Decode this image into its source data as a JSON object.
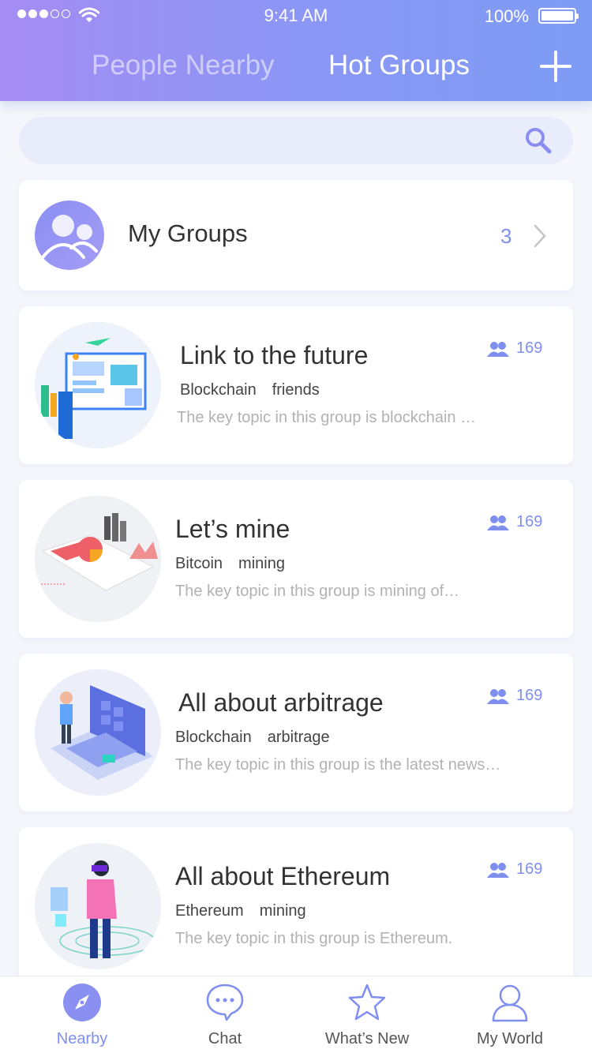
{
  "status_bar": {
    "time": "9:41 AM",
    "battery": "100%"
  },
  "header": {
    "tabs": [
      {
        "label": "People Nearby"
      },
      {
        "label": "Hot Groups"
      }
    ]
  },
  "search": {
    "value": "",
    "placeholder": ""
  },
  "my_groups": {
    "title": "My Groups",
    "count": "3"
  },
  "groups": [
    {
      "title": "Link to the future",
      "tags": [
        "Blockchain",
        "friends"
      ],
      "description": "The key topic in this group is blockchain …",
      "members": "169"
    },
    {
      "title": "Let’s mine",
      "tags": [
        "Bitcoin",
        "mining"
      ],
      "description": "The  key topic in this group is mining of…",
      "members": "169"
    },
    {
      "title": "All about arbitrage",
      "tags": [
        "Blockchain",
        "arbitrage"
      ],
      "description": "The key topic in this group is the latest news…",
      "members": "169"
    },
    {
      "title": "All about Ethereum",
      "tags": [
        "Ethereum",
        "mining"
      ],
      "description": "The key topic in this group is Ethereum.",
      "members": "169"
    }
  ],
  "bottom_nav": [
    {
      "label": "Nearby",
      "icon": "compass-icon",
      "active": true
    },
    {
      "label": "Chat",
      "icon": "chat-bubble-icon",
      "active": false
    },
    {
      "label": "What’s New",
      "icon": "star-icon",
      "active": false
    },
    {
      "label": "My World",
      "icon": "user-icon",
      "active": false
    }
  ],
  "colors": {
    "accent": "#7f8ff0",
    "header_start": "#a48cf3",
    "header_end": "#7e9cf4"
  }
}
